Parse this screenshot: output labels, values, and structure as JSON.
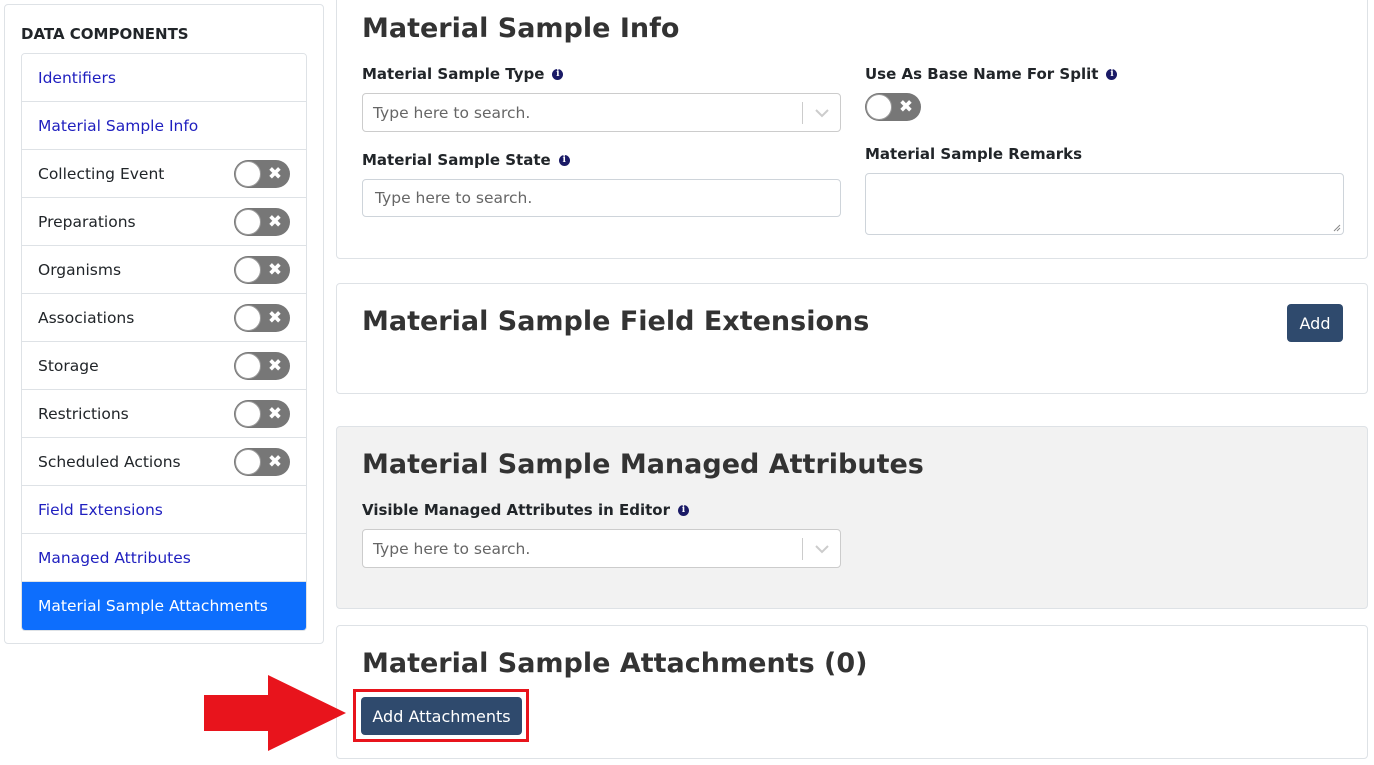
{
  "sidebar": {
    "title": "DATA COMPONENTS",
    "items": [
      {
        "label": "Identifiers",
        "type": "link"
      },
      {
        "label": "Material Sample Info",
        "type": "link"
      },
      {
        "label": "Collecting Event",
        "type": "toggle"
      },
      {
        "label": "Preparations",
        "type": "toggle"
      },
      {
        "label": "Organisms",
        "type": "toggle"
      },
      {
        "label": "Associations",
        "type": "toggle"
      },
      {
        "label": "Storage",
        "type": "toggle"
      },
      {
        "label": "Restrictions",
        "type": "toggle"
      },
      {
        "label": "Scheduled Actions",
        "type": "toggle"
      },
      {
        "label": "Field Extensions",
        "type": "link"
      },
      {
        "label": "Managed Attributes",
        "type": "link"
      },
      {
        "label": "Material Sample Attachments",
        "type": "active"
      }
    ],
    "toggle_symbol": "✖"
  },
  "info_section": {
    "title": "Material Sample Info",
    "type_label": "Material Sample Type",
    "type_placeholder": "Type here to search.",
    "state_label": "Material Sample State",
    "state_placeholder": "Type here to search.",
    "split_label": "Use As Base Name For Split",
    "remarks_label": "Material Sample Remarks"
  },
  "extensions_section": {
    "title": "Material Sample Field Extensions",
    "add_label": "Add"
  },
  "managed_section": {
    "title": "Material Sample Managed Attributes",
    "visible_label": "Visible Managed Attributes in Editor",
    "placeholder": "Type here to search."
  },
  "attachments_section": {
    "title": "Material Sample Attachments (0)",
    "add_label": "Add Attachments"
  },
  "icons": {
    "info": "i"
  },
  "colors": {
    "primary_button": "#2f4a6d",
    "active_nav": "#0d6efd",
    "link": "#1f1fbf",
    "highlight": "#e8141c"
  }
}
